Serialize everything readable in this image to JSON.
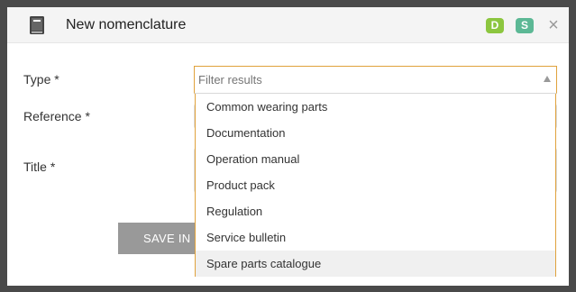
{
  "dialog": {
    "title": "New nomenclature",
    "icon": "book-icon",
    "badges": [
      {
        "label": "D",
        "color": "#8cc63f"
      },
      {
        "label": "S",
        "color": "#5cb895"
      }
    ],
    "close_label": "×"
  },
  "form": {
    "type_label": "Type *",
    "reference_label": "Reference *",
    "title_label": "Title *",
    "save_label": "SAVE IN"
  },
  "type_select": {
    "placeholder": "Filter results",
    "options": [
      "Common wearing parts",
      "Documentation",
      "Operation manual",
      "Product pack",
      "Regulation",
      "Service bulletin",
      "Spare parts catalogue"
    ],
    "highlighted_option": "Spare parts catalogue",
    "accent_color": "#e0a23c"
  }
}
